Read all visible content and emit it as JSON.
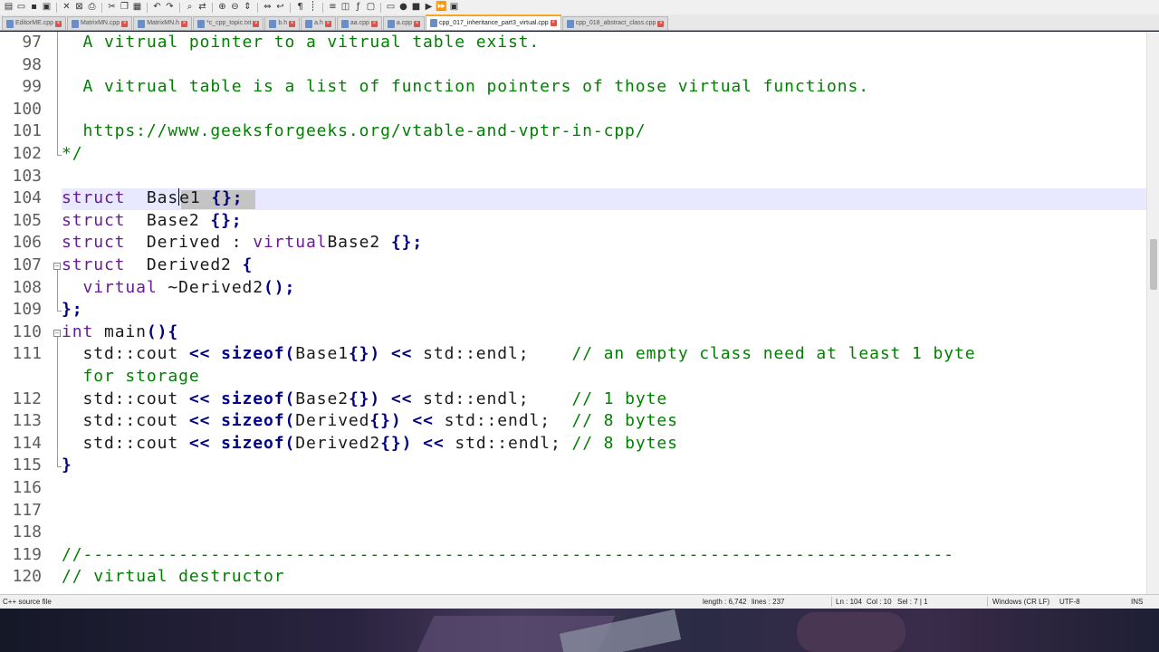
{
  "toolbar": {
    "icons": [
      "new-file",
      "open",
      "save",
      "save-all",
      "close",
      "close-all",
      "print",
      "cut",
      "copy",
      "paste",
      "undo",
      "redo",
      "find",
      "replace",
      "zoom-in",
      "zoom-out",
      "sync-v",
      "sync-h",
      "wrap",
      "all-chars",
      "indent-guide",
      "lang",
      "doc-map",
      "func-list",
      "folder",
      "monitor",
      "record",
      "stop",
      "play",
      "play-multi",
      "save-macro"
    ]
  },
  "tabs": [
    {
      "label": "EditorME.cpp",
      "active": false
    },
    {
      "label": "MatrixMN.cpp",
      "active": false
    },
    {
      "label": "MatrixMN.h",
      "active": false
    },
    {
      "label": "*c_cpp_topic.txt",
      "active": false
    },
    {
      "label": "b.h",
      "active": false
    },
    {
      "label": "a.h",
      "active": false
    },
    {
      "label": "aa.cpp",
      "active": false
    },
    {
      "label": "a.cpp",
      "active": false
    },
    {
      "label": "cpp_017_inheritance_part3_virtual.cpp",
      "active": true
    },
    {
      "label": "cpp_018_abstract_class.cpp",
      "active": false
    }
  ],
  "editor": {
    "lines": [
      {
        "n": "97",
        "parts": [
          [
            "cmt",
            "  A vitrual pointer to a vitrual table exist."
          ]
        ]
      },
      {
        "n": "98",
        "parts": []
      },
      {
        "n": "99",
        "parts": [
          [
            "cmt",
            "  A vitrual table is a list of function pointers of those virtual functions."
          ]
        ]
      },
      {
        "n": "100",
        "parts": []
      },
      {
        "n": "101",
        "parts": [
          [
            "cmt",
            "  https://www.geeksforgeeks.org/vtable-and-vptr-in-cpp/"
          ]
        ]
      },
      {
        "n": "102",
        "parts": [
          [
            "cmt",
            "*/"
          ]
        ]
      },
      {
        "n": "103",
        "parts": []
      },
      {
        "n": "104",
        "parts": [
          [
            "kw",
            "struct"
          ],
          [
            "",
            "  Bas"
          ],
          [
            "caret",
            ""
          ],
          [
            "",
            "e1 "
          ],
          [
            "op",
            "{};"
          ]
        ]
      },
      {
        "n": "105",
        "parts": [
          [
            "kw",
            "struct"
          ],
          [
            "",
            "  Base2 "
          ],
          [
            "op",
            "{};"
          ]
        ]
      },
      {
        "n": "106",
        "parts": [
          [
            "kw",
            "struct"
          ],
          [
            "",
            "  Derived : "
          ],
          [
            "kw",
            "virtual"
          ],
          [
            "",
            "",
            " "
          ],
          [
            "",
            "Base2 "
          ],
          [
            "op",
            "{};"
          ]
        ]
      },
      {
        "n": "107",
        "parts": [
          [
            "kw",
            "struct"
          ],
          [
            "",
            "  Derived2 "
          ],
          [
            "op",
            "{"
          ]
        ]
      },
      {
        "n": "108",
        "parts": [
          [
            "",
            "  "
          ],
          [
            "kw",
            "virtual"
          ],
          [
            "",
            " ~Derived2"
          ],
          [
            "op",
            "();"
          ]
        ]
      },
      {
        "n": "109",
        "parts": [
          [
            "op",
            "};"
          ]
        ]
      },
      {
        "n": "110",
        "parts": [
          [
            "kw",
            "int"
          ],
          [
            "",
            " main"
          ],
          [
            "op",
            "(){"
          ]
        ]
      },
      {
        "n": "111",
        "parts": [
          [
            "",
            "  std::cout "
          ],
          [
            "op",
            "<<"
          ],
          [
            "",
            " "
          ],
          [
            "kb",
            "sizeof"
          ],
          [
            "op",
            "("
          ],
          [
            "",
            "Base1"
          ],
          [
            "op",
            "{})"
          ],
          [
            "",
            " "
          ],
          [
            "op",
            "<<"
          ],
          [
            "",
            " std::endl;    "
          ],
          [
            "cmt",
            "// an empty class need at least 1 byte"
          ]
        ]
      },
      {
        "n": "",
        "parts": [
          [
            "cmt",
            "  for storage"
          ]
        ]
      },
      {
        "n": "112",
        "parts": [
          [
            "",
            "  std::cout "
          ],
          [
            "op",
            "<<"
          ],
          [
            "",
            " "
          ],
          [
            "kb",
            "sizeof"
          ],
          [
            "op",
            "("
          ],
          [
            "",
            "Base2"
          ],
          [
            "op",
            "{})"
          ],
          [
            "",
            " "
          ],
          [
            "op",
            "<<"
          ],
          [
            "",
            " std::endl;    "
          ],
          [
            "cmt",
            "// 1 byte"
          ]
        ]
      },
      {
        "n": "113",
        "parts": [
          [
            "",
            "  std::cout "
          ],
          [
            "op",
            "<<"
          ],
          [
            "",
            " "
          ],
          [
            "kb",
            "sizeof"
          ],
          [
            "op",
            "("
          ],
          [
            "",
            "Derived"
          ],
          [
            "op",
            "{})"
          ],
          [
            "",
            " "
          ],
          [
            "op",
            "<<"
          ],
          [
            "",
            " std::endl;  "
          ],
          [
            "cmt",
            "// 8 bytes"
          ]
        ]
      },
      {
        "n": "114",
        "parts": [
          [
            "",
            "  std::cout "
          ],
          [
            "op",
            "<<"
          ],
          [
            "",
            " "
          ],
          [
            "kb",
            "sizeof"
          ],
          [
            "op",
            "("
          ],
          [
            "",
            "Derived2"
          ],
          [
            "op",
            "{})"
          ],
          [
            "",
            " "
          ],
          [
            "op",
            "<<"
          ],
          [
            "",
            " std::endl; "
          ],
          [
            "cmt",
            "// 8 bytes"
          ]
        ]
      },
      {
        "n": "115",
        "parts": [
          [
            "op",
            "}"
          ]
        ]
      },
      {
        "n": "116",
        "parts": []
      },
      {
        "n": "117",
        "parts": []
      },
      {
        "n": "118",
        "parts": []
      },
      {
        "n": "119",
        "parts": [
          [
            "cmt",
            "//----------------------------------------------------------------------------------"
          ]
        ]
      },
      {
        "n": "120",
        "parts": [
          [
            "cmt",
            "// virtual destructor"
          ]
        ]
      }
    ]
  },
  "status": {
    "filetype": "C++ source file",
    "length": "length : 6,742",
    "lines": "lines : 237",
    "ln": "Ln : 104",
    "col": "Col : 10",
    "sel": "Sel : 7 | 1",
    "eol": "Windows (CR LF)",
    "encoding": "UTF-8",
    "mode": "INS"
  }
}
